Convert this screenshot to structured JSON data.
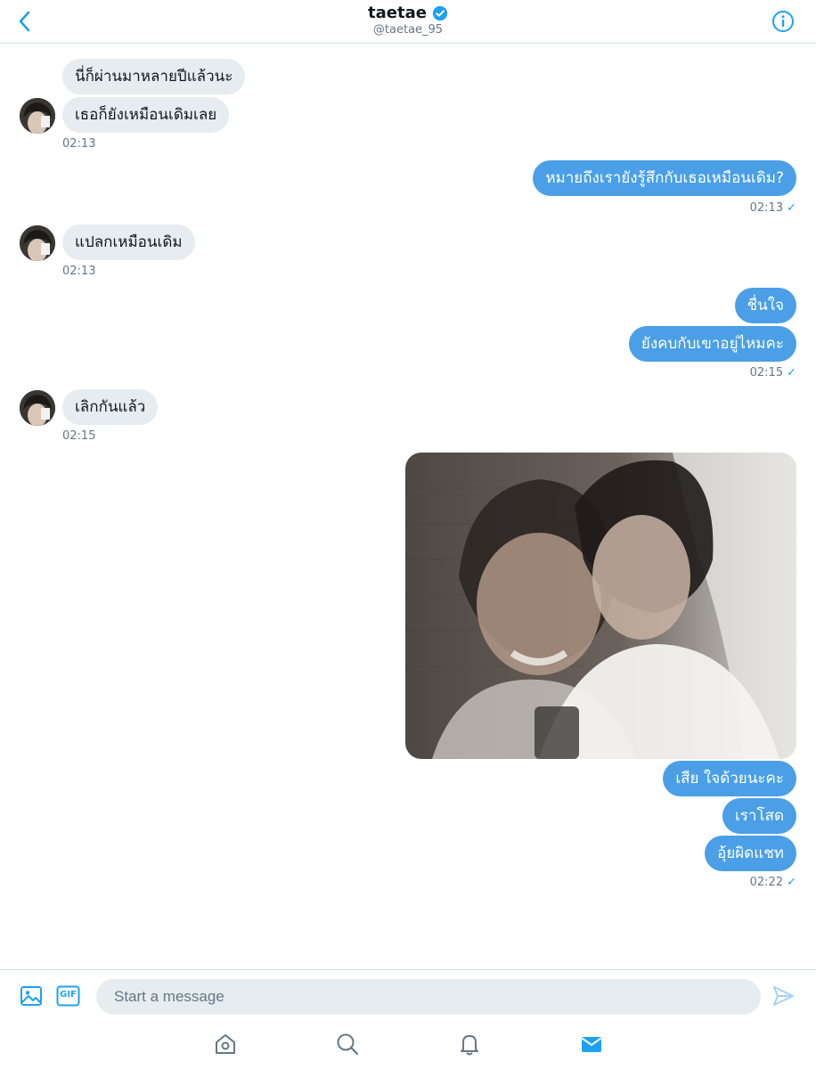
{
  "header": {
    "name": "taetae",
    "handle": "@taetae_95"
  },
  "messages": {
    "m1": "นี่ก็ผ่านมาหลายปีแล้วนะ",
    "m2": "เธอก็ยังเหมือนเดิมเลย",
    "t1": "02:13",
    "m3": "หมายถึงเรายังรู้สึกกับเธอเหมือนเดิม?",
    "t2": "02:13",
    "m4": "แปลกเหมือนเดิม",
    "t3": "02:13",
    "m5": "ชื่นใจ",
    "m6": "ยังคบกับเขาอยู่ไหมคะ",
    "t4": "02:15",
    "m7": "เลิกกันแล้ว",
    "t5": "02:15",
    "m8": "เสีย ใจด้วยนะคะ",
    "m9": "เราโสด",
    "m10": "อุ้ยผิดแชท",
    "t6": "02:22"
  },
  "composer": {
    "placeholder": "Start a message",
    "gif_label": "GIF"
  },
  "icons": {
    "back": "chevron-left-icon",
    "verified": "verified-badge-icon",
    "info": "info-icon",
    "image": "image-icon",
    "gif": "gif-icon",
    "send": "send-icon",
    "home": "home-icon",
    "search": "search-icon",
    "notifications": "bell-icon",
    "messages": "mail-icon"
  },
  "colors": {
    "accent": "#1da1f2",
    "outgoing_bubble": "#4a9fe6",
    "incoming_bubble": "#e6ecf0"
  }
}
